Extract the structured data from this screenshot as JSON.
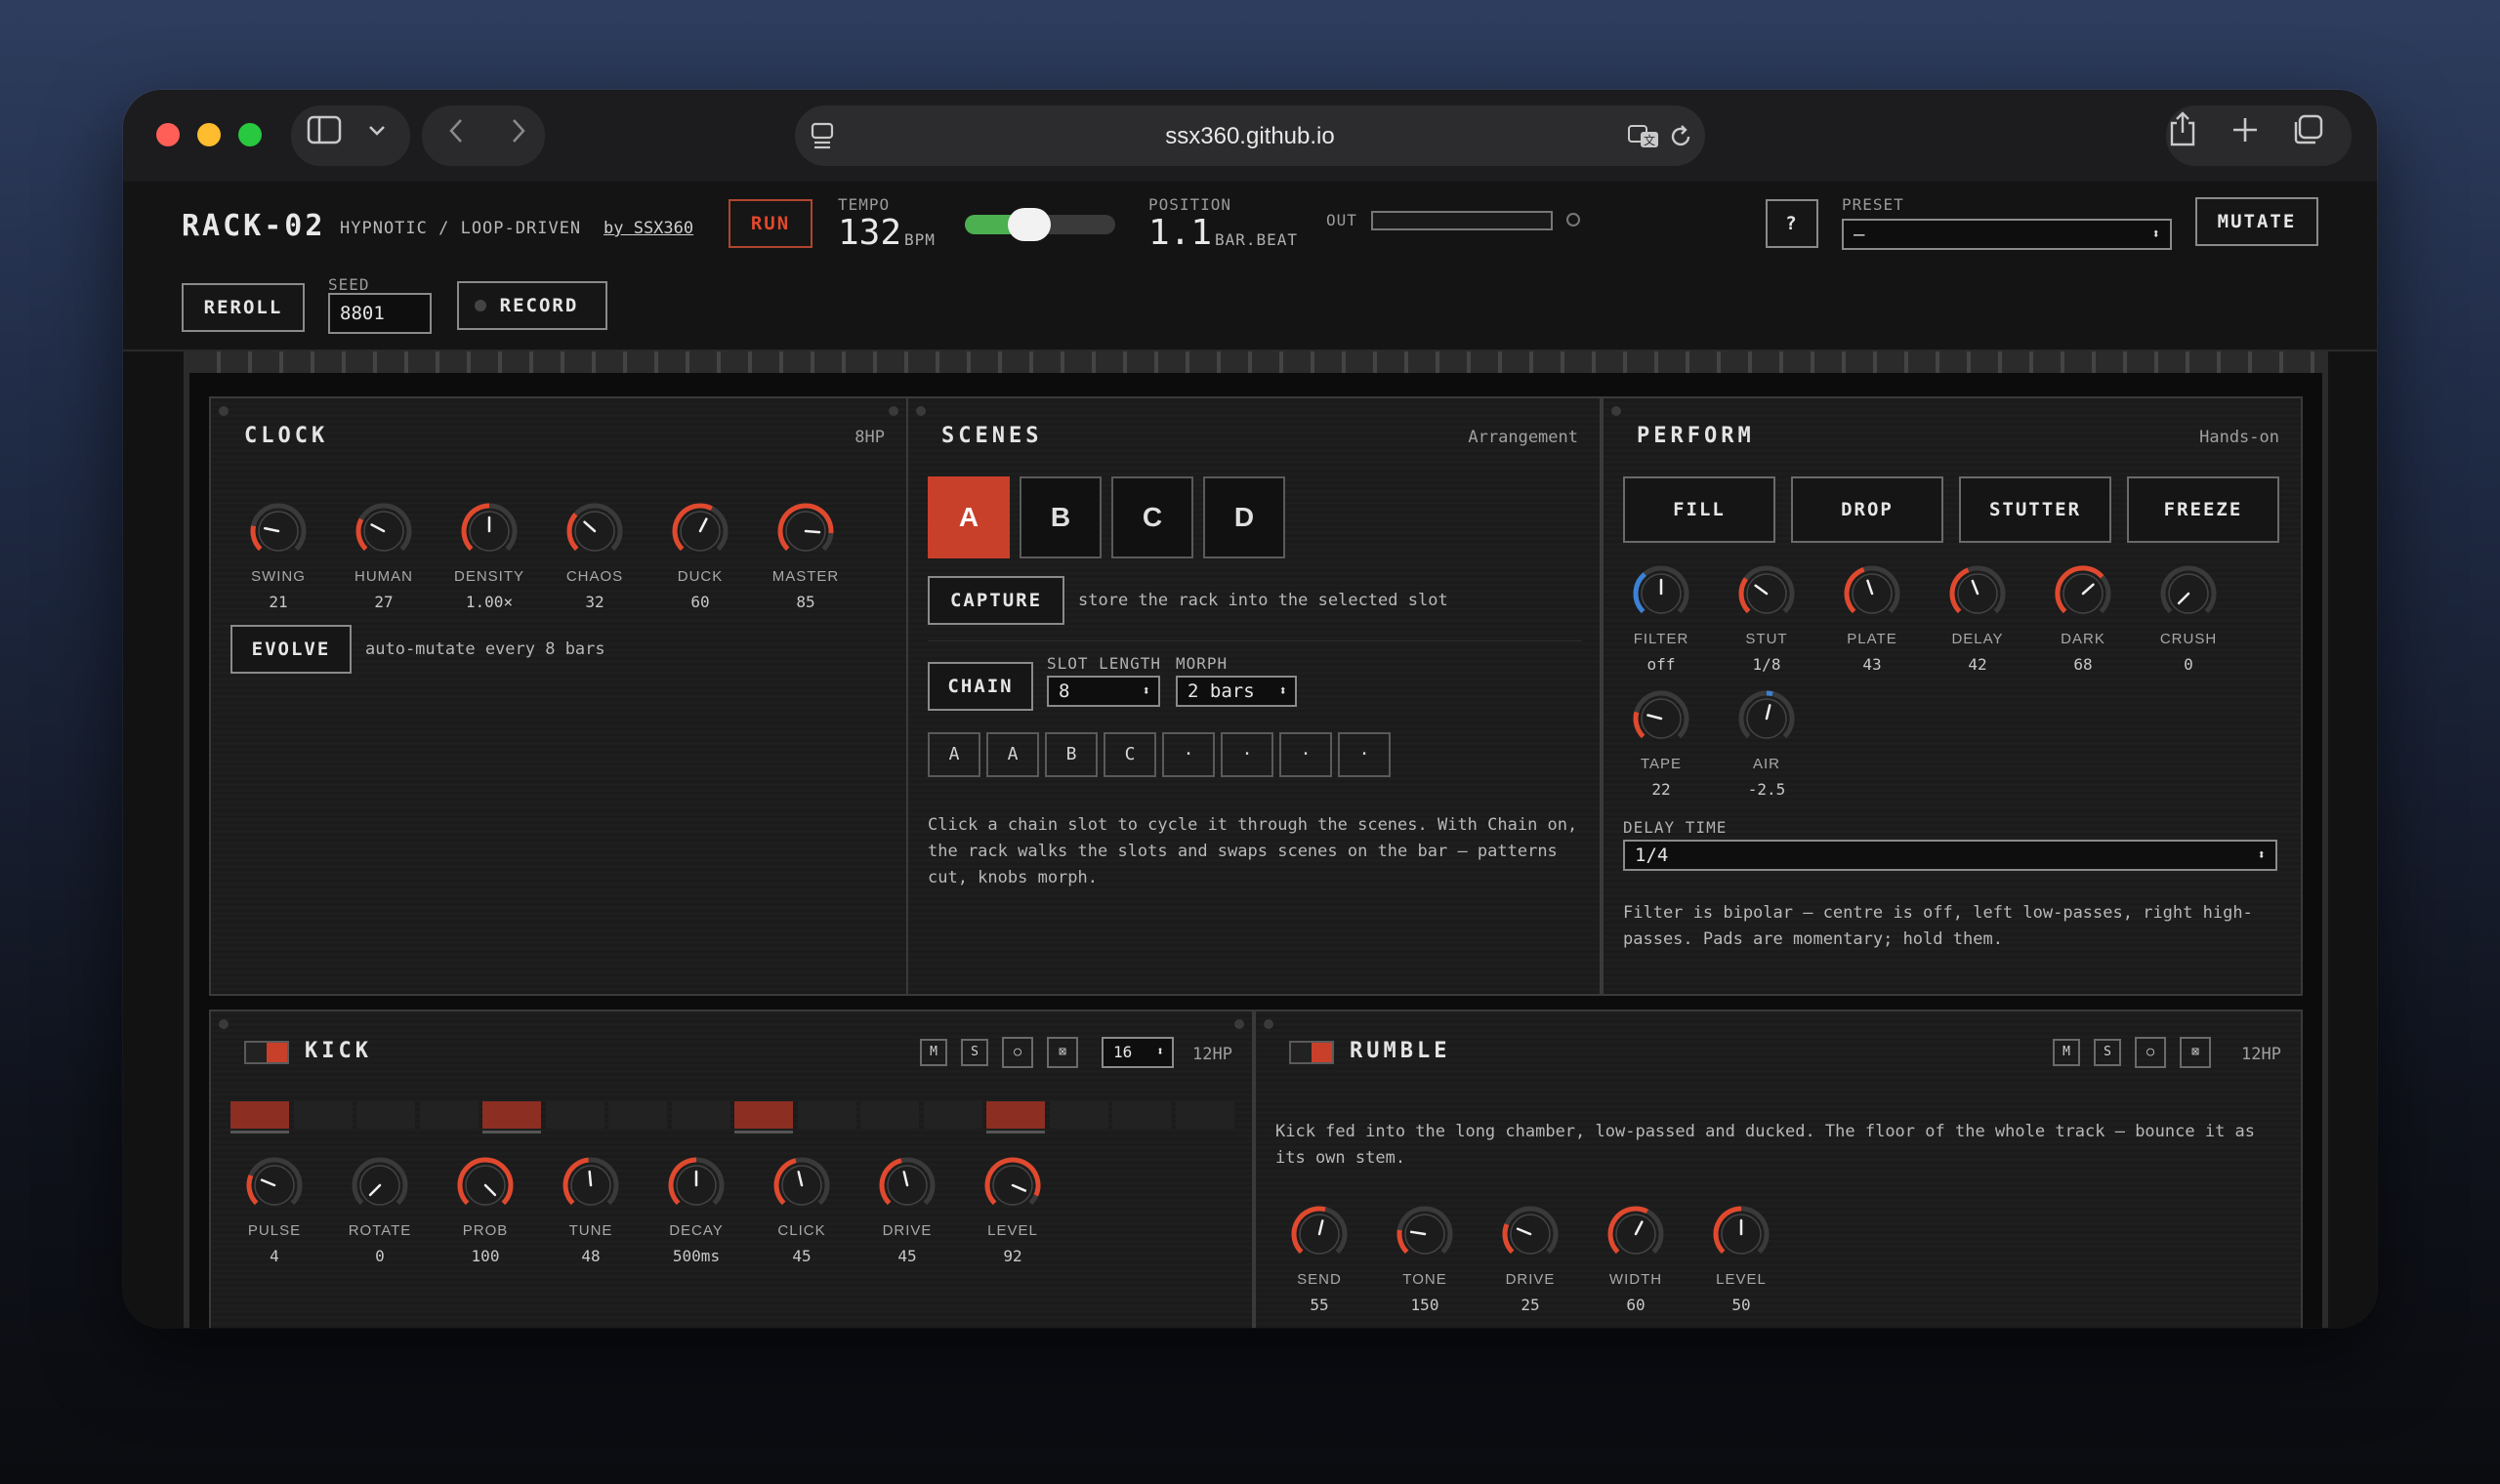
{
  "browser": {
    "url": "ssx360.github.io"
  },
  "header": {
    "title": "RACK-02",
    "subtitle": "HYPNOTIC / LOOP-DRIVEN",
    "byline": "by SSX360",
    "run_label": "RUN",
    "tempo_label": "TEMPO",
    "tempo_value": "132",
    "tempo_unit": "BPM",
    "tempo_slider_fraction": 0.4,
    "position_label": "POSITION",
    "position_value": "1.1",
    "position_unit": "BAR.BEAT",
    "out_label": "OUT",
    "help_label": "?",
    "preset_label": "PRESET",
    "preset_value": "—",
    "mutate_label": "MUTATE",
    "reroll_label": "REROLL",
    "seed_label": "SEED",
    "seed_value": "8801",
    "record_label": "RECORD"
  },
  "clock": {
    "title": "CLOCK",
    "tag": "8HP",
    "knobs": [
      {
        "label": "SWING",
        "value": "21",
        "fraction": 0.21,
        "color": "#e0492e"
      },
      {
        "label": "HUMAN",
        "value": "27",
        "fraction": 0.27,
        "color": "#e0492e"
      },
      {
        "label": "DENSITY",
        "value": "1.00×",
        "fraction": 0.5,
        "color": "#e0492e"
      },
      {
        "label": "CHAOS",
        "value": "32",
        "fraction": 0.32,
        "color": "#e0492e"
      },
      {
        "label": "DUCK",
        "value": "60",
        "fraction": 0.6,
        "color": "#e0492e"
      },
      {
        "label": "MASTER",
        "value": "85",
        "fraction": 0.85,
        "color": "#e0492e"
      }
    ],
    "evolve_label": "EVOLVE",
    "evolve_text": "auto-mutate every 8 bars"
  },
  "scenes": {
    "title": "SCENES",
    "tag": "Arrangement",
    "slots": [
      "A",
      "B",
      "C",
      "D"
    ],
    "selected": "A",
    "capture_label": "CAPTURE",
    "capture_text": "store the rack into the selected slot",
    "chain_label": "CHAIN",
    "slot_length_label": "SLOT LENGTH",
    "slot_length_value": "8",
    "morph_label": "MORPH",
    "morph_value": "2 bars",
    "chain_slots": [
      "A",
      "A",
      "B",
      "C",
      "·",
      "·",
      "·",
      "·"
    ],
    "help_text": "Click a chain slot to cycle it through the scenes. With Chain on, the rack walks the slots and swaps scenes on the bar — patterns cut, knobs morph."
  },
  "perform": {
    "title": "PERFORM",
    "tag": "Hands-on",
    "pads": [
      "FILL",
      "DROP",
      "STUTTER",
      "FREEZE"
    ],
    "knobs": [
      {
        "label": "FILTER",
        "value": "off",
        "fraction": 0.5,
        "color": "#3b82d6"
      },
      {
        "label": "STUT",
        "value": "1/8",
        "fraction": 0.3,
        "color": "#e0492e"
      },
      {
        "label": "PLATE",
        "value": "43",
        "fraction": 0.43,
        "color": "#e0492e"
      },
      {
        "label": "DELAY",
        "value": "42",
        "fraction": 0.42,
        "color": "#e0492e"
      },
      {
        "label": "DARK",
        "value": "68",
        "fraction": 0.68,
        "color": "#e0492e"
      },
      {
        "label": "CRUSH",
        "value": "0",
        "fraction": 0.0,
        "color": "#e0492e"
      },
      {
        "label": "TAPE",
        "value": "22",
        "fraction": 0.22,
        "color": "#e0492e"
      },
      {
        "label": "AIR",
        "value": "-2.5",
        "fraction": 0.55,
        "color": "#3b82d6"
      }
    ],
    "delay_time_label": "DELAY TIME",
    "delay_time_value": "1/4",
    "help_text": "Filter is bipolar — centre is off, left low-passes, right high-passes. Pads are momentary; hold them."
  },
  "kick": {
    "title": "KICK",
    "tag": "12HP",
    "m_label": "M",
    "s_label": "S",
    "steps_value": "16",
    "steps": [
      1,
      0,
      0,
      0,
      1,
      0,
      0,
      0,
      1,
      0,
      0,
      0,
      1,
      0,
      0,
      0
    ],
    "knobs": [
      {
        "label": "PULSE",
        "value": "4",
        "fraction": 0.25,
        "color": "#e0492e"
      },
      {
        "label": "ROTATE",
        "value": "0",
        "fraction": 0.0,
        "color": "#e0492e"
      },
      {
        "label": "PROB",
        "value": "100",
        "fraction": 1.0,
        "color": "#e0492e"
      },
      {
        "label": "TUNE",
        "value": "48",
        "fraction": 0.48,
        "color": "#e0492e"
      },
      {
        "label": "DECAY",
        "value": "500ms",
        "fraction": 0.5,
        "color": "#e0492e"
      },
      {
        "label": "CLICK",
        "value": "45",
        "fraction": 0.45,
        "color": "#e0492e"
      },
      {
        "label": "DRIVE",
        "value": "45",
        "fraction": 0.45,
        "color": "#e0492e"
      },
      {
        "label": "LEVEL",
        "value": "92",
        "fraction": 0.92,
        "color": "#e0492e"
      }
    ]
  },
  "rumble": {
    "title": "RUMBLE",
    "tag": "12HP",
    "m_label": "M",
    "s_label": "S",
    "text": "Kick fed into the long chamber, low-passed and ducked. The floor of the whole track — bounce it as its own stem.",
    "knobs": [
      {
        "label": "SEND",
        "value": "55",
        "fraction": 0.55,
        "color": "#e0492e"
      },
      {
        "label": "TONE",
        "value": "150",
        "fraction": 0.2,
        "color": "#e0492e"
      },
      {
        "label": "DRIVE",
        "value": "25",
        "fraction": 0.25,
        "color": "#e0492e"
      },
      {
        "label": "WIDTH",
        "value": "60",
        "fraction": 0.6,
        "color": "#e0492e"
      },
      {
        "label": "LEVEL",
        "value": "50",
        "fraction": 0.5,
        "color": "#e0492e"
      }
    ]
  }
}
